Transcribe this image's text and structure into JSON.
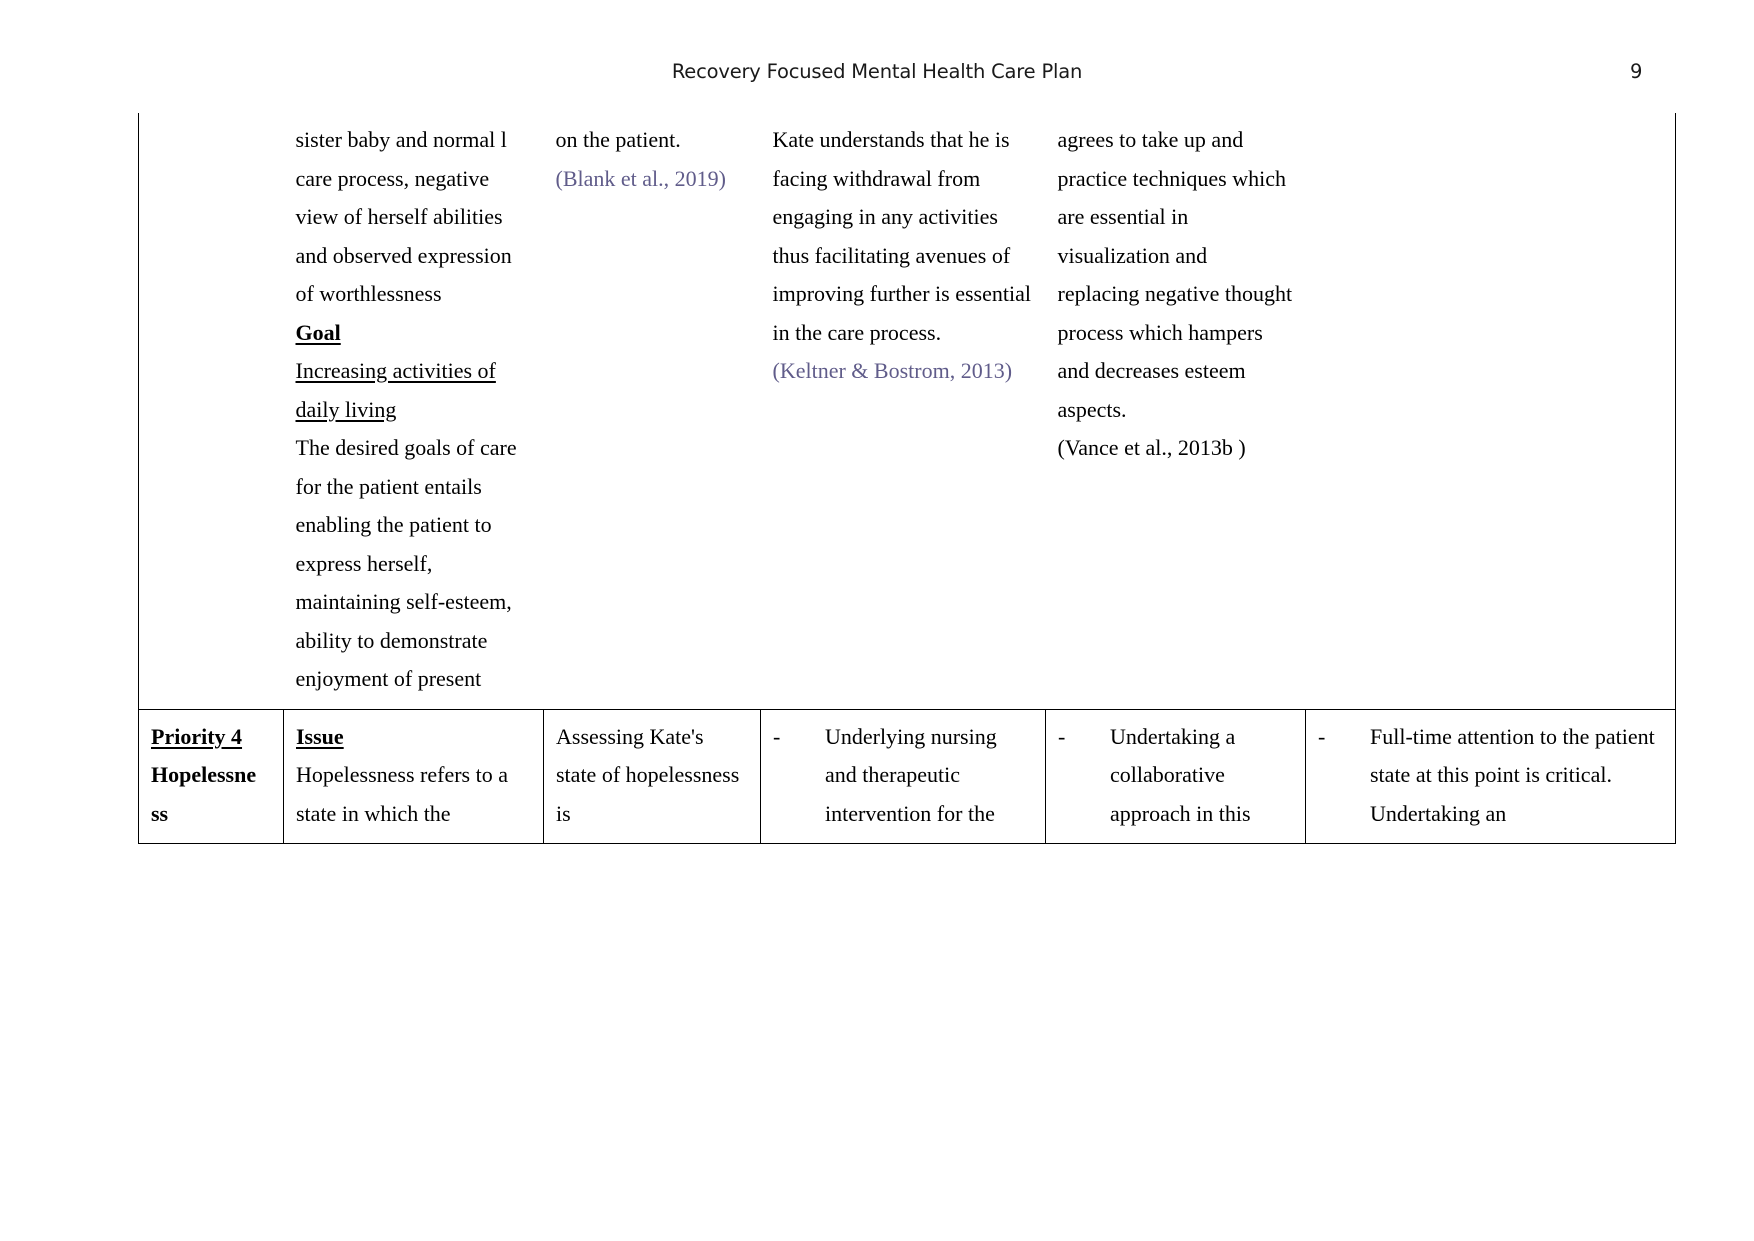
{
  "header": {
    "title": "Recovery Focused Mental Health Care Plan",
    "page_number": "9"
  },
  "colors": {
    "citation": "#605c8a",
    "text": "#000000",
    "rule": "#000000"
  },
  "table": {
    "rows": [
      {
        "kind": "continuation",
        "cells": {
          "priority": "",
          "issue_goal": {
            "body_before": "sister baby and normal l care process, negative view of herself abilities and observed expression of worthlessness",
            "goal_heading": "Goal ",
            "goal_underlined": "Increasing activities of daily living",
            "goal_body": "The desired goals of care for the patient entails enabling the patient to express herself, maintaining self-esteem, ability to demonstrate enjoyment of present"
          },
          "assessment": {
            "body": "on the patient.",
            "citation": "(Blank et al., 2019)"
          },
          "intervention": {
            "body": "Kate understands that he is facing withdrawal from engaging in any activities thus facilitating avenues of improving further is essential in the care process.",
            "citation": "(Keltner & Bostrom, 2013)"
          },
          "implementation": {
            "body": "agrees to take up and practice techniques which are essential in visualization and replacing negative thought process which hampers and decreases esteem aspects.",
            "citation": "(Vance et al., 2013b )"
          },
          "evaluation": ""
        }
      },
      {
        "kind": "priority",
        "cells": {
          "priority": {
            "label": "Priority 4",
            "name": "Hopelessne ss"
          },
          "issue_goal": {
            "heading": "Issue",
            "body": "Hopelessness refers to a state in which the"
          },
          "assessment": {
            "body": "Assessing Kate's state of hopelessness is"
          },
          "intervention": {
            "marker": "-",
            "body": "Underlying nursing and therapeutic intervention for the"
          },
          "implementation": {
            "marker": "-",
            "body": "Undertaking a collaborative approach in this"
          },
          "evaluation": {
            "marker": "-",
            "body": "Full-time attention to the patient state at this point is critical. Undertaking an"
          }
        }
      }
    ]
  }
}
